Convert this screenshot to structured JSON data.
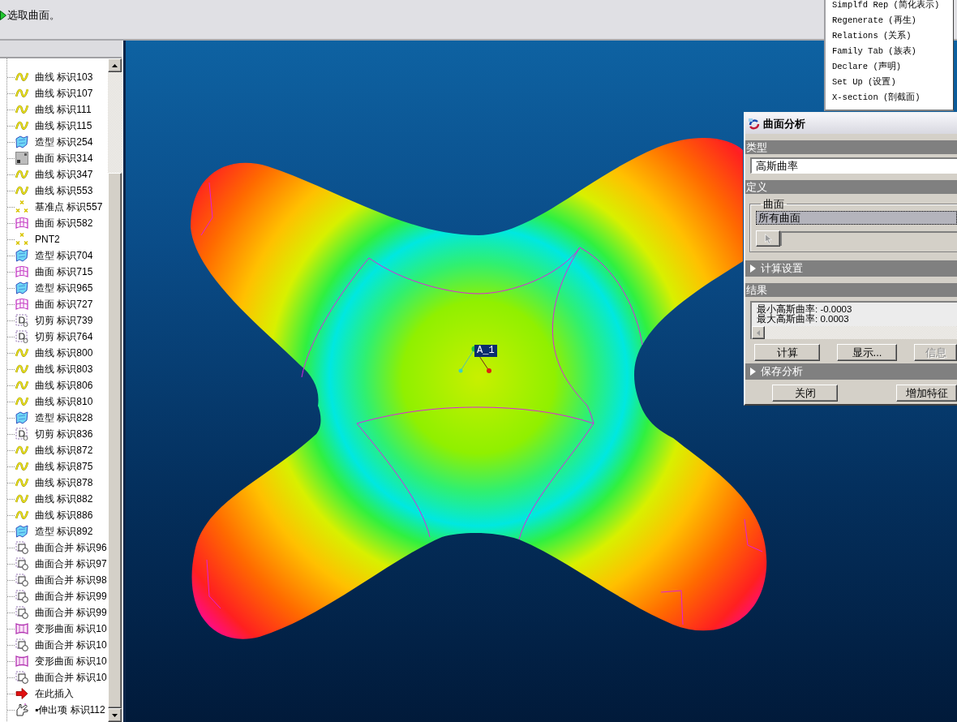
{
  "message_bar": {
    "text": "选取曲面。"
  },
  "model_tree": {
    "items": [
      {
        "kind": "curve",
        "label": "曲线 标识103"
      },
      {
        "kind": "curve",
        "label": "曲线 标识107"
      },
      {
        "kind": "curve",
        "label": "曲线 标识111"
      },
      {
        "kind": "curve",
        "label": "曲线 标识115"
      },
      {
        "kind": "style",
        "label": "造型 标识254"
      },
      {
        "kind": "surface_plain",
        "label": "曲面 标识314"
      },
      {
        "kind": "curve",
        "label": "曲线 标识347"
      },
      {
        "kind": "curve",
        "label": "曲线 标识553"
      },
      {
        "kind": "datum_point",
        "label": "基准点 标识557"
      },
      {
        "kind": "surface",
        "label": "曲面 标识582"
      },
      {
        "kind": "datum_point",
        "label": "PNT2"
      },
      {
        "kind": "style",
        "label": "造型 标识704"
      },
      {
        "kind": "surface",
        "label": "曲面 标识715"
      },
      {
        "kind": "style",
        "label": "造型 标识965"
      },
      {
        "kind": "surface",
        "label": "曲面 标识727"
      },
      {
        "kind": "cut",
        "label": "切剪 标识739"
      },
      {
        "kind": "cut",
        "label": "切剪 标识764"
      },
      {
        "kind": "curve",
        "label": "曲线 标识800"
      },
      {
        "kind": "curve",
        "label": "曲线 标识803"
      },
      {
        "kind": "curve",
        "label": "曲线 标识806"
      },
      {
        "kind": "curve",
        "label": "曲线 标识810"
      },
      {
        "kind": "style",
        "label": "造型 标识828"
      },
      {
        "kind": "cut",
        "label": "切剪 标识836"
      },
      {
        "kind": "curve",
        "label": "曲线 标识872"
      },
      {
        "kind": "curve",
        "label": "曲线 标识875"
      },
      {
        "kind": "curve",
        "label": "曲线 标识878"
      },
      {
        "kind": "curve",
        "label": "曲线 标识882"
      },
      {
        "kind": "curve",
        "label": "曲线 标识886"
      },
      {
        "kind": "style",
        "label": "造型 标识892"
      },
      {
        "kind": "merge",
        "label": "曲面合并 标识96"
      },
      {
        "kind": "merge",
        "label": "曲面合并 标识97"
      },
      {
        "kind": "merge",
        "label": "曲面合并 标识98"
      },
      {
        "kind": "merge",
        "label": "曲面合并 标识99"
      },
      {
        "kind": "merge",
        "label": "曲面合并 标识99"
      },
      {
        "kind": "warp",
        "label": "变形曲面 标识10"
      },
      {
        "kind": "merge",
        "label": "曲面合并 标识10"
      },
      {
        "kind": "warp",
        "label": "变形曲面 标识10"
      },
      {
        "kind": "merge",
        "label": "曲面合并 标识10"
      },
      {
        "kind": "insert",
        "label": "在此插入"
      },
      {
        "kind": "extrude",
        "label": "▪伸出项 标识112"
      }
    ]
  },
  "menu": {
    "items": [
      "Simplfd Rep (简化表示)",
      "Regenerate (再生)",
      "Relations (关系)",
      "Family Tab (族表)",
      "Declare (声明)",
      "Set Up (设置)",
      "X-section (剖截面)"
    ]
  },
  "viewport": {
    "axis_label": "A_1"
  },
  "dialog": {
    "title": "曲面分析",
    "sections": [
      {
        "kind": "header",
        "label": "类型"
      },
      {
        "kind": "field",
        "value": "高斯曲率"
      },
      {
        "kind": "header",
        "label": "定义"
      },
      {
        "kind": "group",
        "label": "曲面",
        "list_items": [
          {
            "label": "所有曲面",
            "selected": true
          }
        ]
      },
      {
        "kind": "collapsible",
        "label": "计算设置",
        "expanded": false
      },
      {
        "kind": "header",
        "label": "结果"
      },
      {
        "kind": "results",
        "lines": [
          "最小高斯曲率: -0.0003",
          "最大高斯曲率: 0.0003"
        ]
      },
      {
        "kind": "buttons",
        "buttons": [
          {
            "label": "计算",
            "disabled": false
          },
          {
            "label": "显示...",
            "disabled": false
          },
          {
            "label": "信息",
            "disabled": true
          }
        ]
      },
      {
        "kind": "collapsible",
        "label": "保存分析",
        "expanded": false
      },
      {
        "kind": "buttons",
        "buttons": [
          {
            "label": "关闭",
            "disabled": false
          },
          {
            "label": "增加特征",
            "disabled": false
          }
        ]
      }
    ]
  }
}
